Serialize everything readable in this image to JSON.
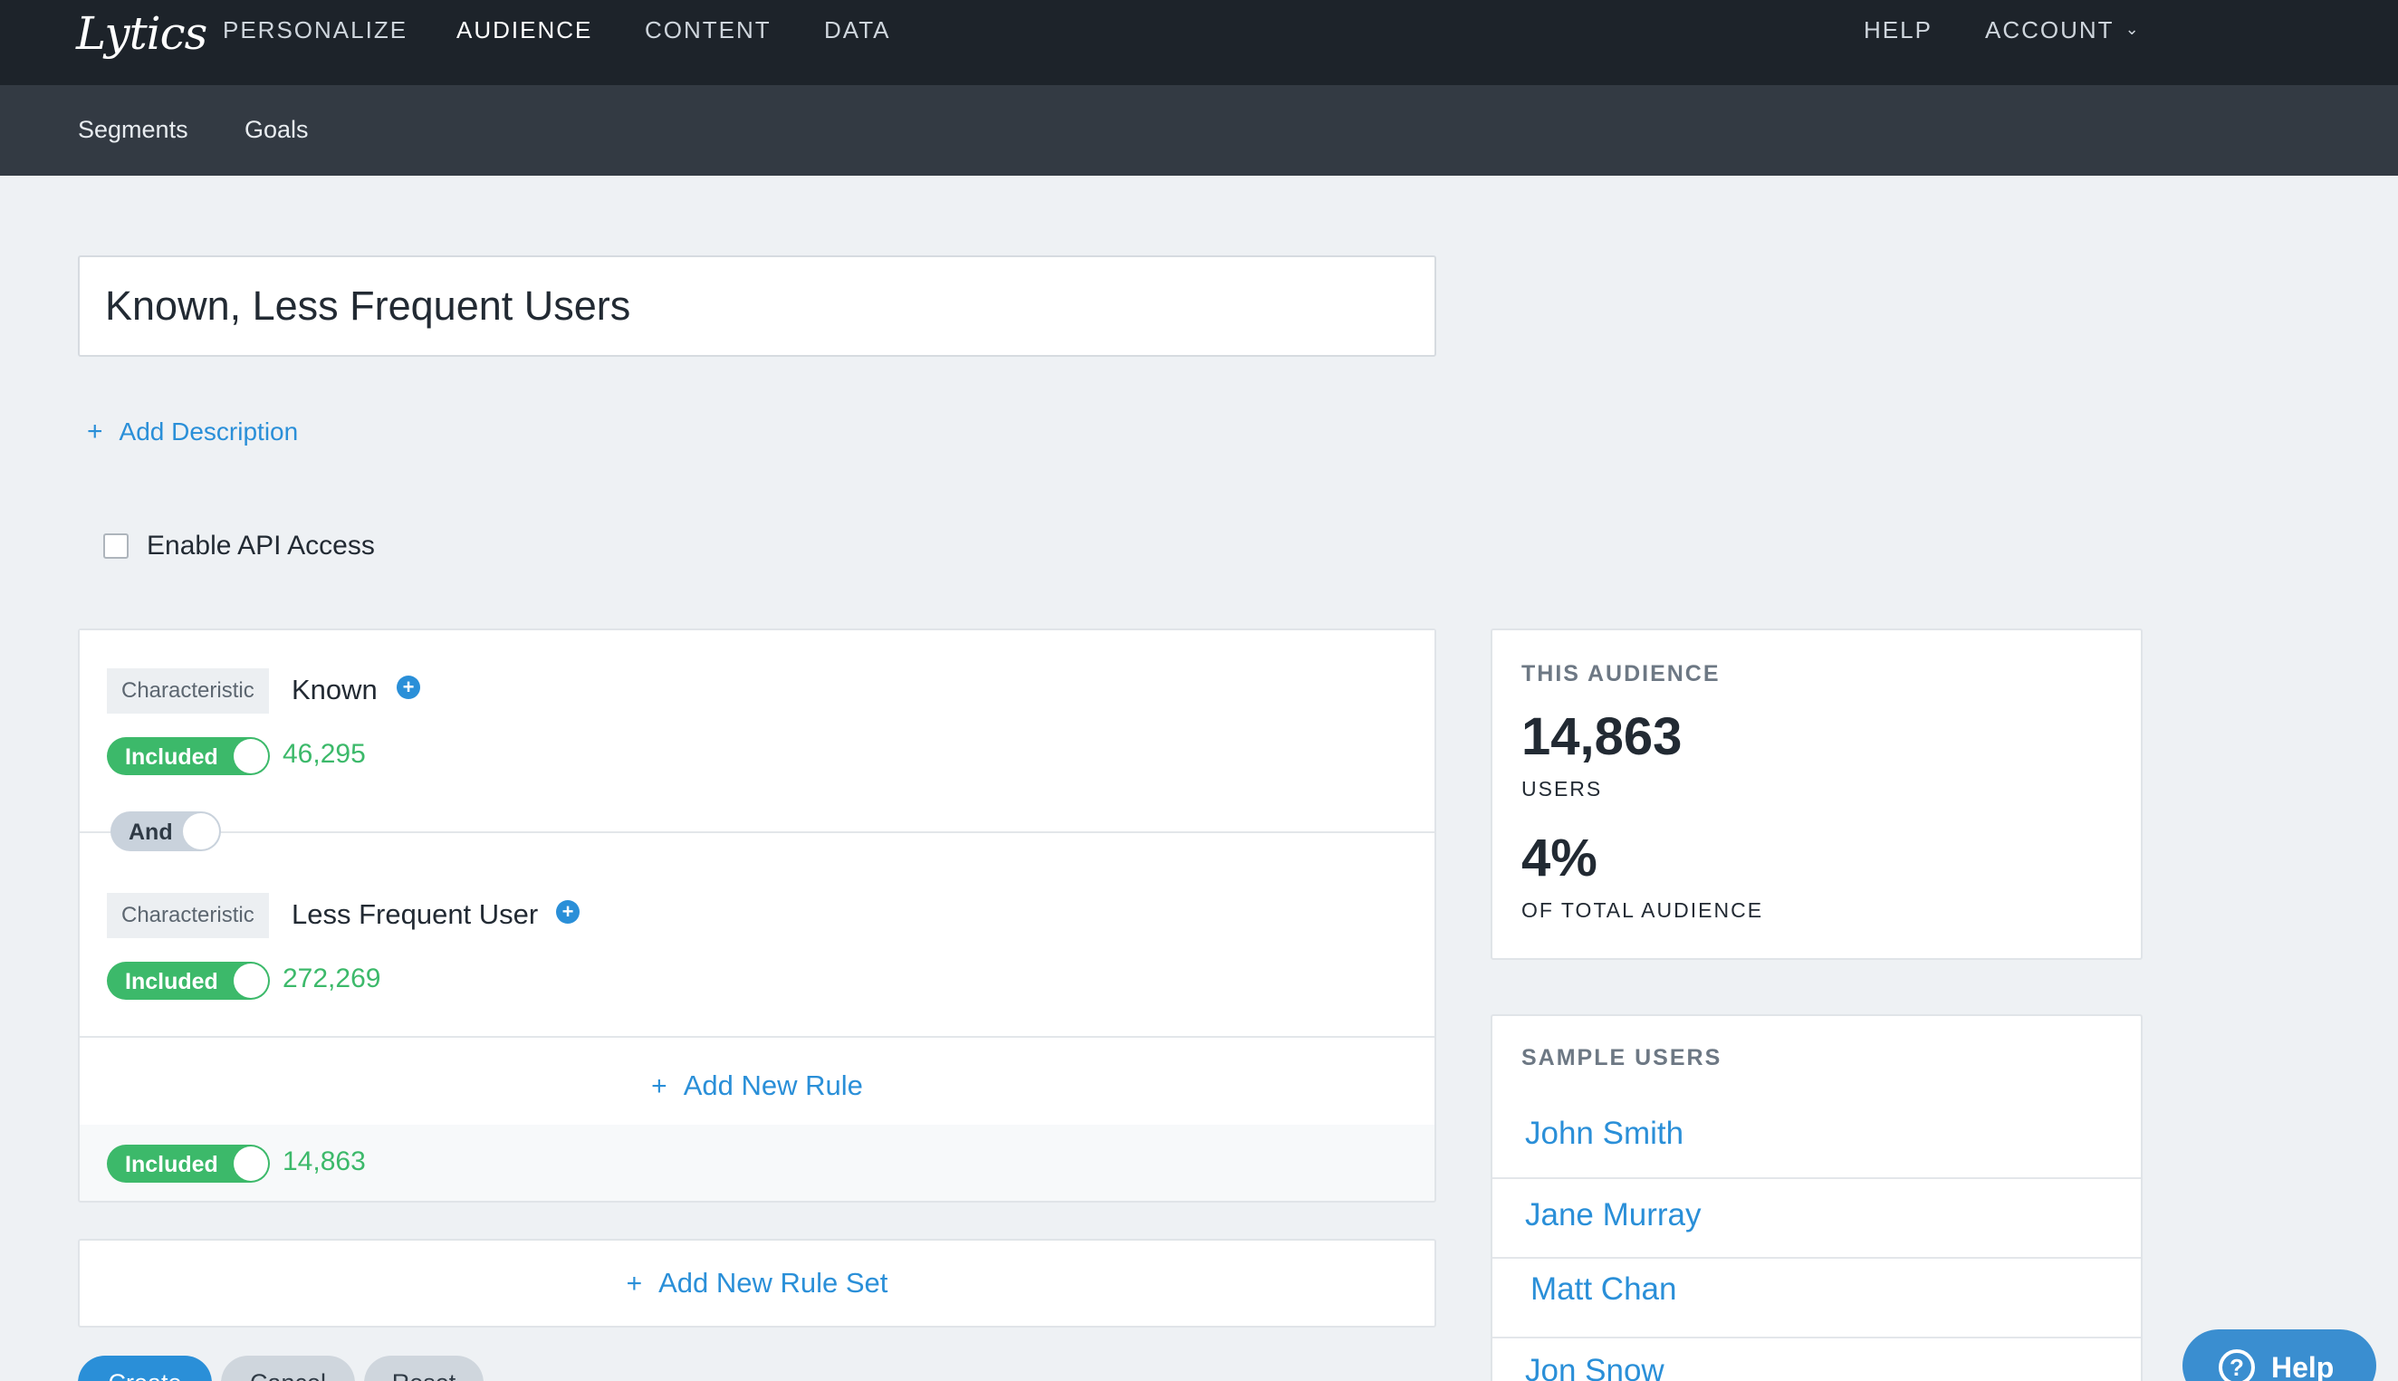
{
  "brand": {
    "logo": "Lytics"
  },
  "topnav": {
    "items": [
      "PERSONALIZE",
      "AUDIENCE",
      "CONTENT",
      "DATA"
    ],
    "right": [
      "HELP",
      "ACCOUNT"
    ]
  },
  "subnav": {
    "items": [
      "Segments",
      "Goals"
    ]
  },
  "segment": {
    "title_value": "Known, Less Frequent Users",
    "add_description": "Add Description",
    "api_access_label": "Enable API Access",
    "api_access_checked": false
  },
  "rules": [
    {
      "tag": "Characteristic",
      "name": "Known",
      "toggle": "Included",
      "count": "46,295"
    },
    {
      "tag": "Characteristic",
      "name": "Less Frequent User",
      "toggle": "Included",
      "count": "272,269"
    }
  ],
  "operator": "And",
  "add_rule": "Add New Rule",
  "ruleset_summary": {
    "toggle": "Included",
    "count": "14,863"
  },
  "add_rule_set": "Add New Rule Set",
  "buttons": {
    "create": "Create",
    "cancel": "Cancel",
    "reset": "Reset"
  },
  "audience": {
    "heading": "THIS AUDIENCE",
    "users_count": "14,863",
    "users_label": "USERS",
    "percent": "4%",
    "percent_label": "OF TOTAL AUDIENCE"
  },
  "sample_users": {
    "heading": "SAMPLE USERS",
    "items": [
      "John Smith",
      "Jane Murray",
      "Matt Chan",
      "Jon Snow"
    ]
  },
  "help_widget": {
    "label": "Help"
  },
  "colors": {
    "nav_bg": "#1d232a",
    "subnav_bg": "#333a43",
    "accent_blue": "#2a8fd8",
    "include_green": "#3cb96a",
    "page_bg": "#eef1f4"
  }
}
